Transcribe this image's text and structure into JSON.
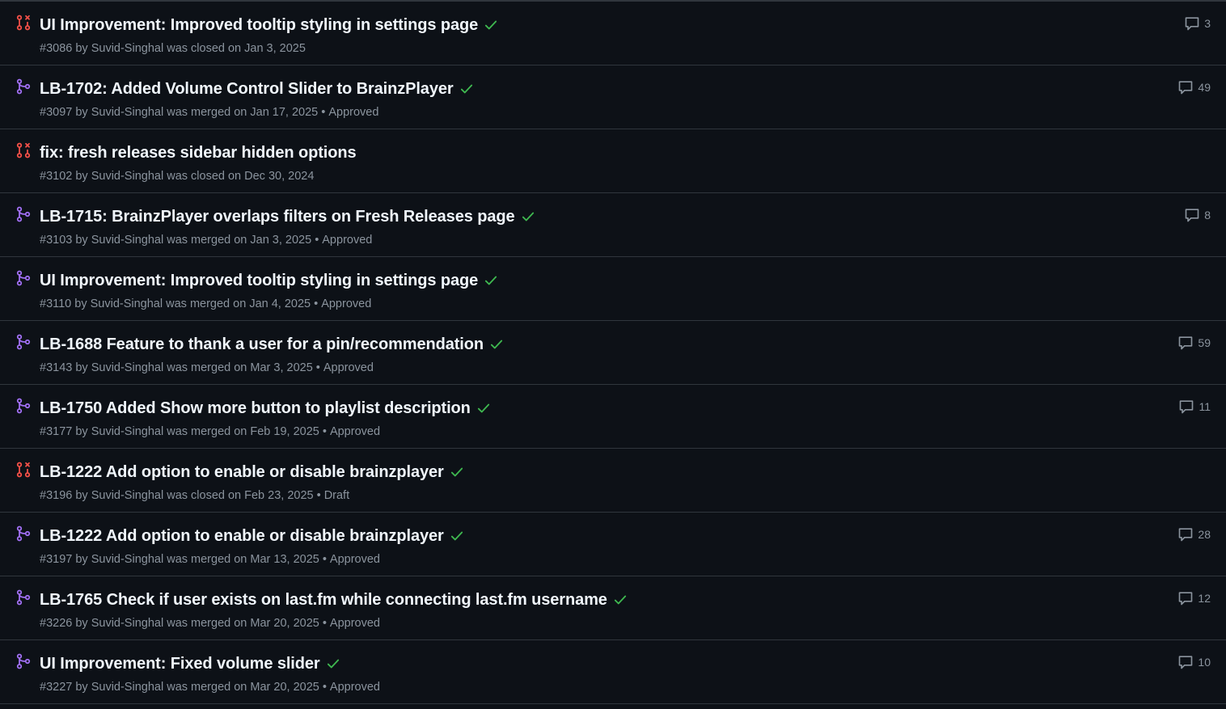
{
  "colors": {
    "background": "#0d1117",
    "border": "#30363d",
    "title": "#f0f6fc",
    "meta": "#8b949e",
    "merged": "#a371f7",
    "closed": "#f85149",
    "check": "#3fb950"
  },
  "pull_requests": [
    {
      "state": "closed",
      "state_icon": "git-pull-request-closed-icon",
      "title": "UI Improvement: Improved tooltip styling in settings page",
      "checks": true,
      "number": "#3086",
      "author": "Suvid-Singhal",
      "action": "was closed on",
      "date": "Jan 3, 2025",
      "review": "",
      "comments": "3"
    },
    {
      "state": "merged",
      "state_icon": "git-merge-icon",
      "title": "LB-1702: Added Volume Control Slider to BrainzPlayer",
      "checks": true,
      "number": "#3097",
      "author": "Suvid-Singhal",
      "action": "was merged on",
      "date": "Jan 17, 2025",
      "review": "Approved",
      "comments": "49"
    },
    {
      "state": "closed",
      "state_icon": "git-pull-request-closed-icon",
      "title": "fix: fresh releases sidebar hidden options",
      "checks": false,
      "number": "#3102",
      "author": "Suvid-Singhal",
      "action": "was closed on",
      "date": "Dec 30, 2024",
      "review": "",
      "comments": ""
    },
    {
      "state": "merged",
      "state_icon": "git-merge-icon",
      "title": "LB-1715: BrainzPlayer overlaps filters on Fresh Releases page",
      "checks": true,
      "number": "#3103",
      "author": "Suvid-Singhal",
      "action": "was merged on",
      "date": "Jan 3, 2025",
      "review": "Approved",
      "comments": "8"
    },
    {
      "state": "merged",
      "state_icon": "git-merge-icon",
      "title": "UI Improvement: Improved tooltip styling in settings page",
      "checks": true,
      "number": "#3110",
      "author": "Suvid-Singhal",
      "action": "was merged on",
      "date": "Jan 4, 2025",
      "review": "Approved",
      "comments": ""
    },
    {
      "state": "merged",
      "state_icon": "git-merge-icon",
      "title": "LB-1688 Feature to thank a user for a pin/recommendation",
      "checks": true,
      "number": "#3143",
      "author": "Suvid-Singhal",
      "action": "was merged on",
      "date": "Mar 3, 2025",
      "review": "Approved",
      "comments": "59"
    },
    {
      "state": "merged",
      "state_icon": "git-merge-icon",
      "title": "LB-1750 Added Show more button to playlist description",
      "checks": true,
      "number": "#3177",
      "author": "Suvid-Singhal",
      "action": "was merged on",
      "date": "Feb 19, 2025",
      "review": "Approved",
      "comments": "11"
    },
    {
      "state": "closed",
      "state_icon": "git-pull-request-closed-icon",
      "title": "LB-1222 Add option to enable or disable brainzplayer",
      "checks": true,
      "number": "#3196",
      "author": "Suvid-Singhal",
      "action": "was closed on",
      "date": "Feb 23, 2025",
      "review": "Draft",
      "comments": ""
    },
    {
      "state": "merged",
      "state_icon": "git-merge-icon",
      "title": "LB-1222 Add option to enable or disable brainzplayer",
      "checks": true,
      "number": "#3197",
      "author": "Suvid-Singhal",
      "action": "was merged on",
      "date": "Mar 13, 2025",
      "review": "Approved",
      "comments": "28"
    },
    {
      "state": "merged",
      "state_icon": "git-merge-icon",
      "title": "LB-1765 Check if user exists on last.fm while connecting last.fm username",
      "checks": true,
      "number": "#3226",
      "author": "Suvid-Singhal",
      "action": "was merged on",
      "date": "Mar 20, 2025",
      "review": "Approved",
      "comments": "12"
    },
    {
      "state": "merged",
      "state_icon": "git-merge-icon",
      "title": "UI Improvement: Fixed volume slider",
      "checks": true,
      "number": "#3227",
      "author": "Suvid-Singhal",
      "action": "was merged on",
      "date": "Mar 20, 2025",
      "review": "Approved",
      "comments": "10"
    }
  ]
}
